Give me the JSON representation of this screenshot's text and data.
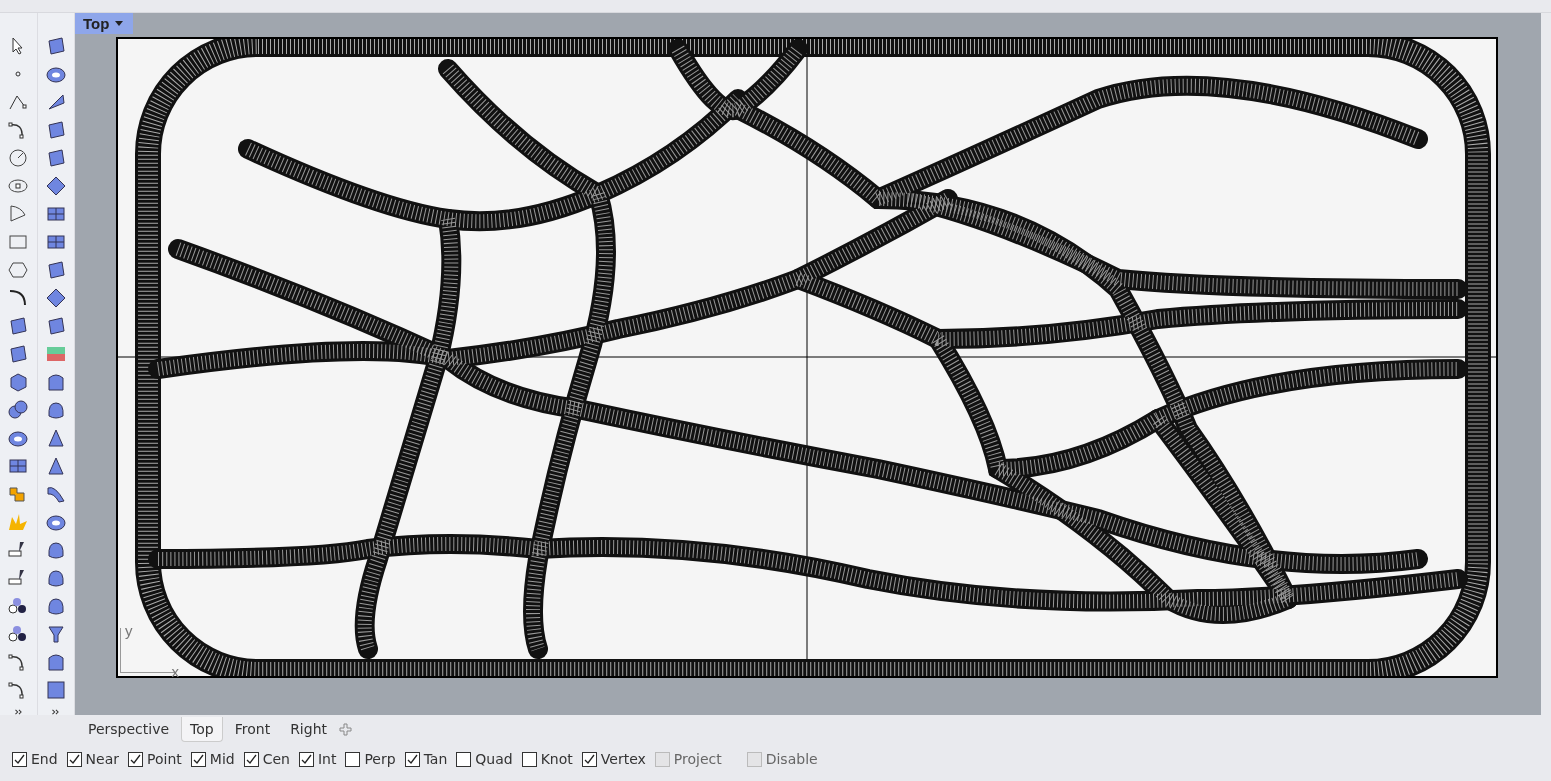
{
  "viewport": {
    "title": "Top",
    "axis_x": "x",
    "axis_y": "y"
  },
  "view_tabs": [
    {
      "label": "Perspective",
      "selected": false
    },
    {
      "label": "Top",
      "selected": true
    },
    {
      "label": "Front",
      "selected": false
    },
    {
      "label": "Right",
      "selected": false
    }
  ],
  "osnaps": [
    {
      "label": "End",
      "checked": true,
      "disabled": false
    },
    {
      "label": "Near",
      "checked": true,
      "disabled": false
    },
    {
      "label": "Point",
      "checked": true,
      "disabled": false
    },
    {
      "label": "Mid",
      "checked": true,
      "disabled": false
    },
    {
      "label": "Cen",
      "checked": true,
      "disabled": false
    },
    {
      "label": "Int",
      "checked": true,
      "disabled": false
    },
    {
      "label": "Perp",
      "checked": false,
      "disabled": false
    },
    {
      "label": "Tan",
      "checked": true,
      "disabled": false
    },
    {
      "label": "Quad",
      "checked": false,
      "disabled": false
    },
    {
      "label": "Knot",
      "checked": false,
      "disabled": false
    },
    {
      "label": "Vertex",
      "checked": true,
      "disabled": false
    },
    {
      "label": "Project",
      "checked": false,
      "disabled": true
    },
    {
      "label": "Disable",
      "checked": false,
      "disabled": true
    }
  ]
}
